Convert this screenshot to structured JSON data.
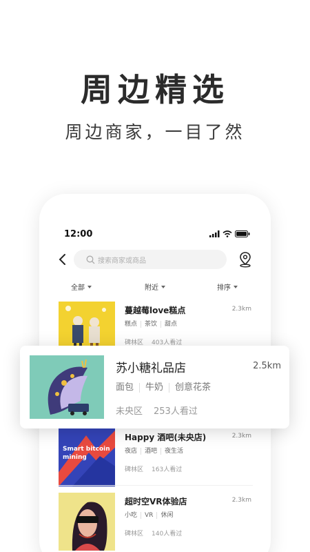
{
  "hero": {
    "title": "周边精选",
    "subtitle": "周边商家，一目了然"
  },
  "status_bar": {
    "time": "12:00"
  },
  "search": {
    "placeholder": "搜索商家或商品"
  },
  "filters": [
    {
      "label": "全部"
    },
    {
      "label": "附近"
    },
    {
      "label": "排序"
    }
  ],
  "featured": {
    "name": "苏小糖礼品店",
    "distance": "2.5km",
    "tags": [
      "面包",
      "牛奶",
      "创意花茶"
    ],
    "district": "未央区",
    "views": "253人看过"
  },
  "items": [
    {
      "name": "蔓越莓love糕点",
      "distance": "2.3km",
      "tags": [
        "糕点",
        "茶饮",
        "甜点"
      ],
      "district": "碑林区",
      "views": "403人看过"
    },
    {
      "name": "Happy 酒吧(未央店)",
      "distance": "2.3km",
      "tags": [
        "夜店",
        "酒吧",
        "夜生活"
      ],
      "district": "碑林区",
      "views": "163人看过",
      "thumb_text": "Smart bitcoin mining"
    },
    {
      "name": "超时空VR体验店",
      "distance": "2.3km",
      "tags": [
        "小吃",
        "VR",
        "休闲"
      ],
      "district": "碑林区",
      "views": "140人看过"
    }
  ],
  "colors": {
    "accent": "#2b2b2b",
    "thumb_yellow": "#f3d230",
    "thumb_teal": "#7fcbb8",
    "thumb_blue": "#3444b8"
  }
}
